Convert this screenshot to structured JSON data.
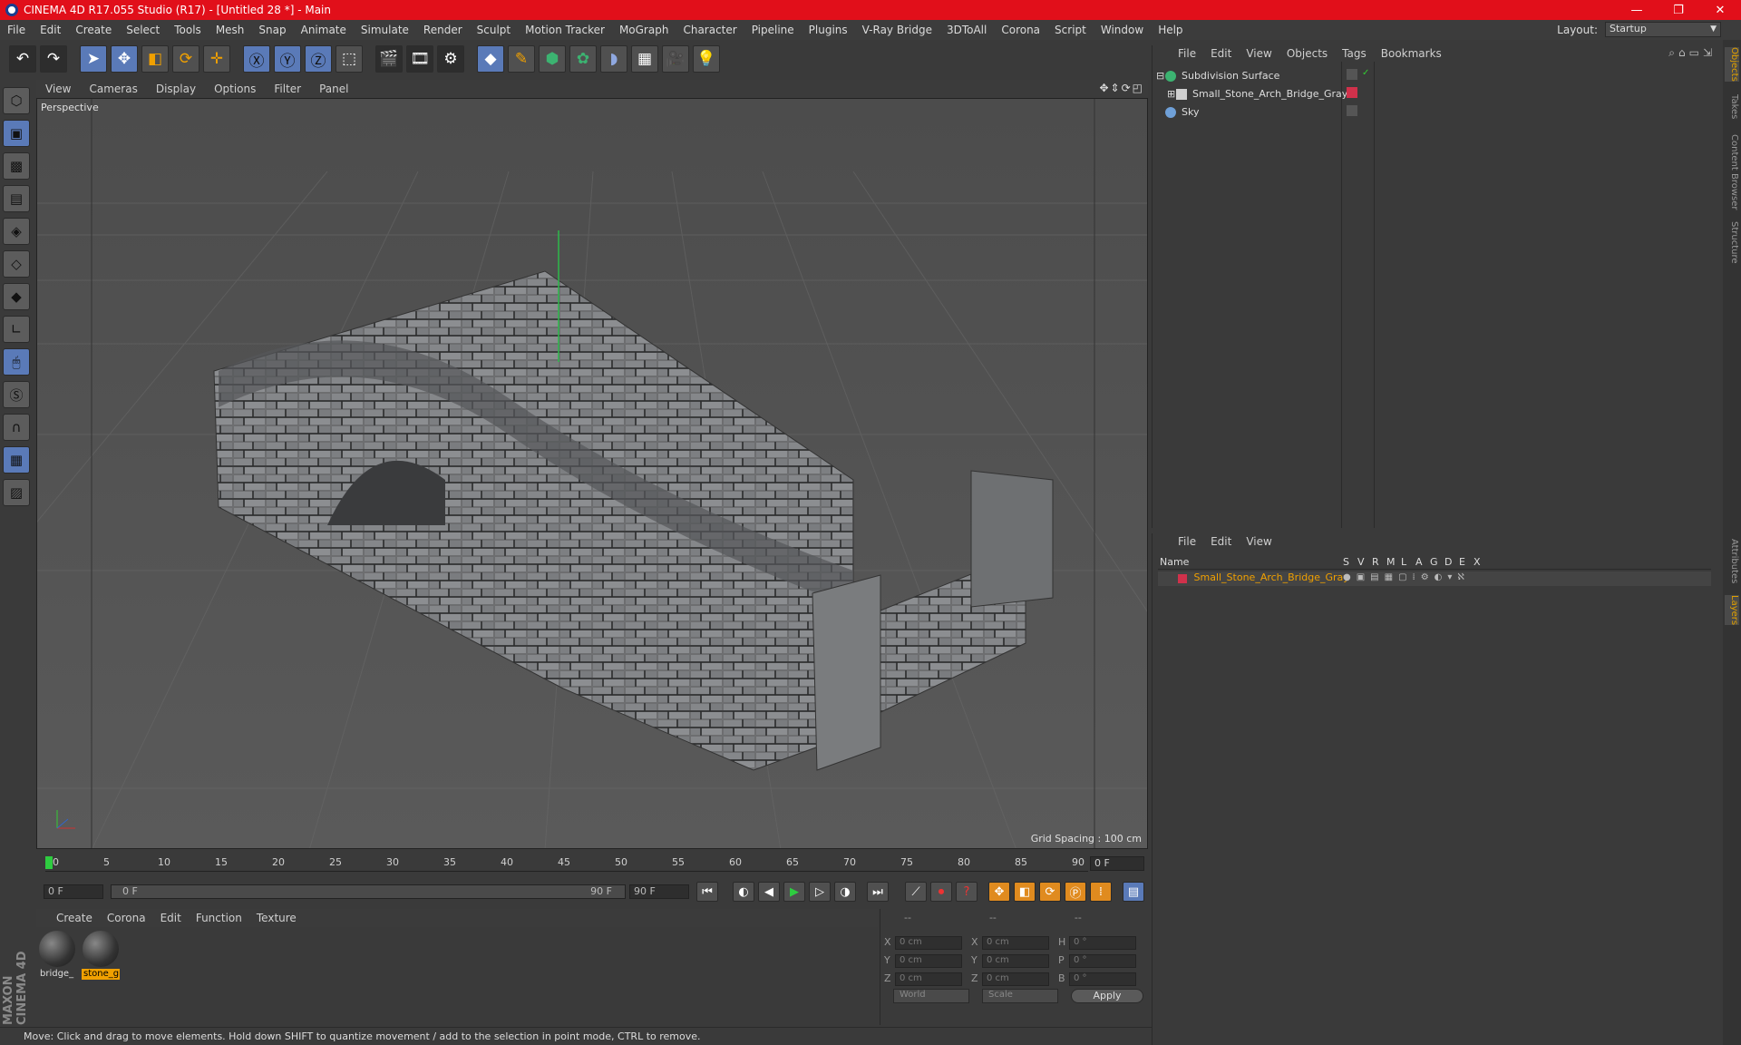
{
  "titlebar": {
    "title": "CINEMA 4D R17.055 Studio (R17) - [Untitled 28 *] - Main",
    "minimize": "—",
    "restore": "❐",
    "close": "✕"
  },
  "menubar": {
    "items": [
      "File",
      "Edit",
      "Create",
      "Select",
      "Tools",
      "Mesh",
      "Snap",
      "Animate",
      "Simulate",
      "Render",
      "Sculpt",
      "Motion Tracker",
      "MoGraph",
      "Character",
      "Pipeline",
      "Plugins",
      "V-Ray Bridge",
      "3DToAll",
      "Corona",
      "Script",
      "Window",
      "Help"
    ],
    "layout_label": "Layout:",
    "layout_value": "Startup"
  },
  "viewport": {
    "menu": [
      "View",
      "Cameras",
      "Display",
      "Options",
      "Filter",
      "Panel"
    ],
    "label": "Perspective",
    "grid_spacing": "Grid Spacing : 100 cm"
  },
  "timeline": {
    "ticks": [
      "0",
      "5",
      "10",
      "15",
      "20",
      "25",
      "30",
      "35",
      "40",
      "45",
      "50",
      "55",
      "60",
      "65",
      "70",
      "75",
      "80",
      "85",
      "90"
    ],
    "current_frame": "0 F",
    "start_field": "0 F",
    "range_start": "0 F",
    "range_end": "90 F",
    "end_field": "90 F"
  },
  "materials": {
    "menu": [
      "Create",
      "Corona",
      "Edit",
      "Function",
      "Texture"
    ],
    "items": [
      {
        "name": "bridge_"
      },
      {
        "name": "stone_g"
      }
    ]
  },
  "coords": {
    "headers": [
      "--",
      "--",
      "--"
    ],
    "rows": [
      {
        "a": "X",
        "av": "0 cm",
        "b": "X",
        "bv": "0 cm",
        "c": "H",
        "cv": "0 °"
      },
      {
        "a": "Y",
        "av": "0 cm",
        "b": "Y",
        "bv": "0 cm",
        "c": "P",
        "cv": "0 °"
      },
      {
        "a": "Z",
        "av": "0 cm",
        "b": "Z",
        "bv": "0 cm",
        "c": "B",
        "cv": "0 °"
      }
    ],
    "space": "World",
    "mode": "Scale",
    "apply": "Apply"
  },
  "status": "Move: Click and drag to move elements. Hold down SHIFT to quantize movement / add to the selection in point mode, CTRL to remove.",
  "objects": {
    "menu": [
      "File",
      "Edit",
      "View",
      "Objects",
      "Tags",
      "Bookmarks"
    ],
    "items": [
      {
        "name": "Subdivision Surface",
        "color": "#3cb371"
      },
      {
        "name": "Small_Stone_Arch_Bridge_Gray",
        "color": "#d0d0d0"
      },
      {
        "name": "Sky",
        "color": "#6fa0d8"
      }
    ]
  },
  "layers": {
    "menu": [
      "File",
      "Edit",
      "View"
    ],
    "columns": [
      "Name",
      "S",
      "V",
      "R",
      "M",
      "L",
      "A",
      "G",
      "D",
      "E",
      "X"
    ],
    "row": "Small_Stone_Arch_Bridge_Gray"
  },
  "sidetabs": [
    "Objects",
    "Takes",
    "Content Browser",
    "Structure",
    "Attributes",
    "Layers"
  ],
  "brand": "MAXON CINEMA 4D",
  "colors": {
    "accent": "#e10f1a",
    "selection": "#f0a000",
    "tool_blue": "#5a7ab8"
  }
}
